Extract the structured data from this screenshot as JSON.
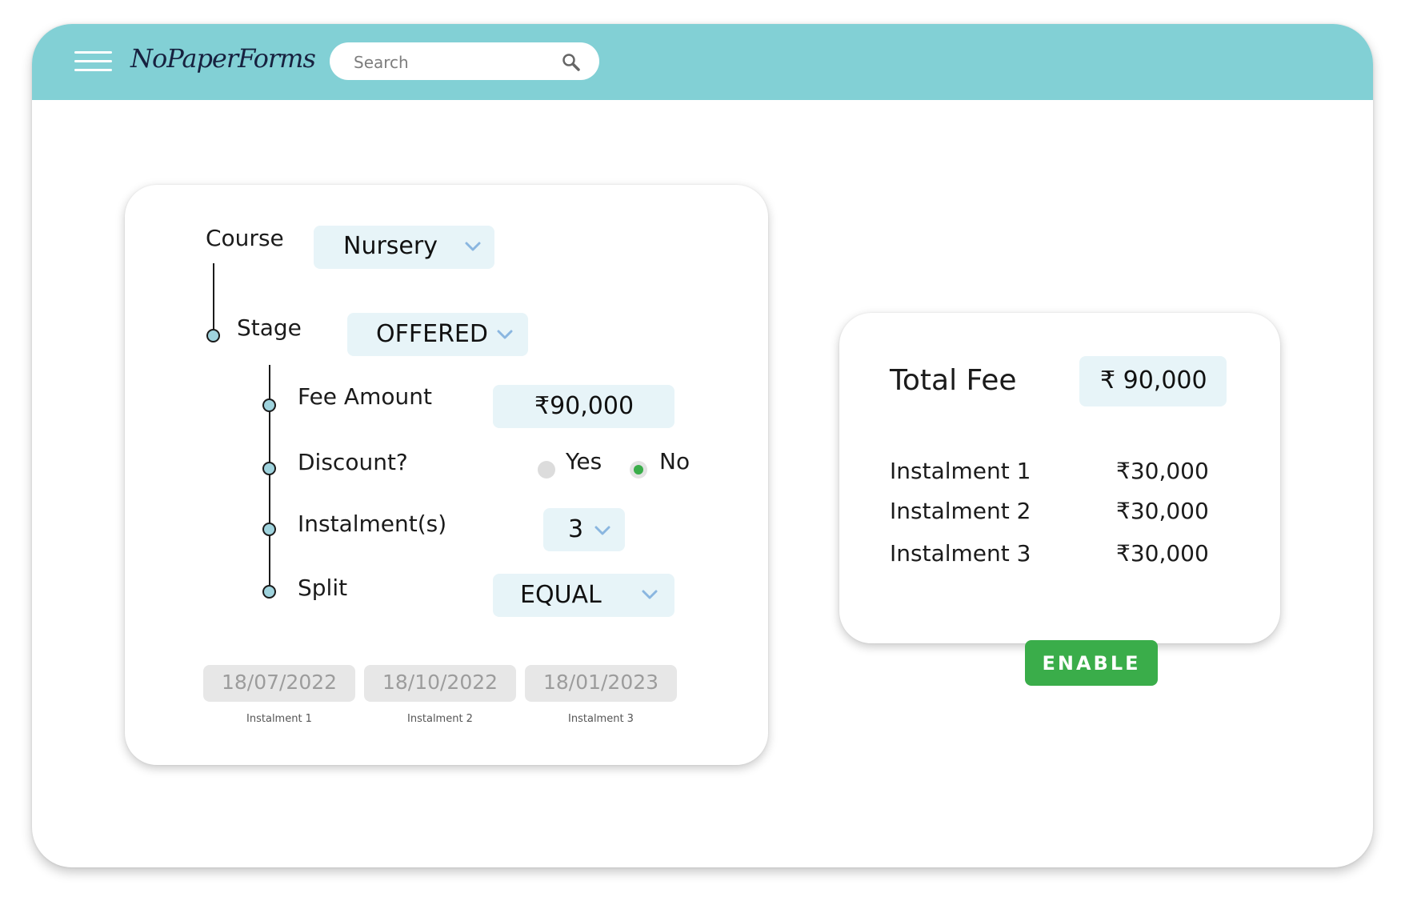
{
  "app": {
    "logo_text": "NoPaperForms"
  },
  "header": {
    "search_placeholder": "Search",
    "icons": {
      "menu": "hamburger-menu-icon",
      "search": "search-icon"
    }
  },
  "form": {
    "course_label": "Course",
    "course_value": "Nursery",
    "stage_label": "Stage",
    "stage_value": "OFFERED",
    "fee_label": "Fee Amount",
    "fee_value": "₹90,000",
    "discount_label": "Discount?",
    "discount_yes": "Yes",
    "discount_no": "No",
    "discount_selected": "No",
    "instalments_label": "Instalment(s)",
    "instalments_value": "3",
    "split_label": "Split",
    "split_value": "EQUAL",
    "dates": [
      {
        "date": "18/07/2022",
        "caption": "Instalment 1"
      },
      {
        "date": "18/10/2022",
        "caption": "Instalment 2"
      },
      {
        "date": "18/01/2023",
        "caption": "Instalment 3"
      }
    ]
  },
  "summary": {
    "total_label": "Total Fee",
    "total_value": "₹ 90,000",
    "rows": [
      {
        "label": "Instalment 1",
        "value": "₹30,000"
      },
      {
        "label": "Instalment 2",
        "value": "₹30,000"
      },
      {
        "label": "Instalment 3",
        "value": "₹30,000"
      }
    ]
  },
  "enable_button": {
    "label": "ENABLE"
  },
  "colors": {
    "header": "#82d0d5",
    "field_bg": "#e7f4f8",
    "accent_green": "#3aad4a",
    "chevron": "#8ab6e0"
  }
}
